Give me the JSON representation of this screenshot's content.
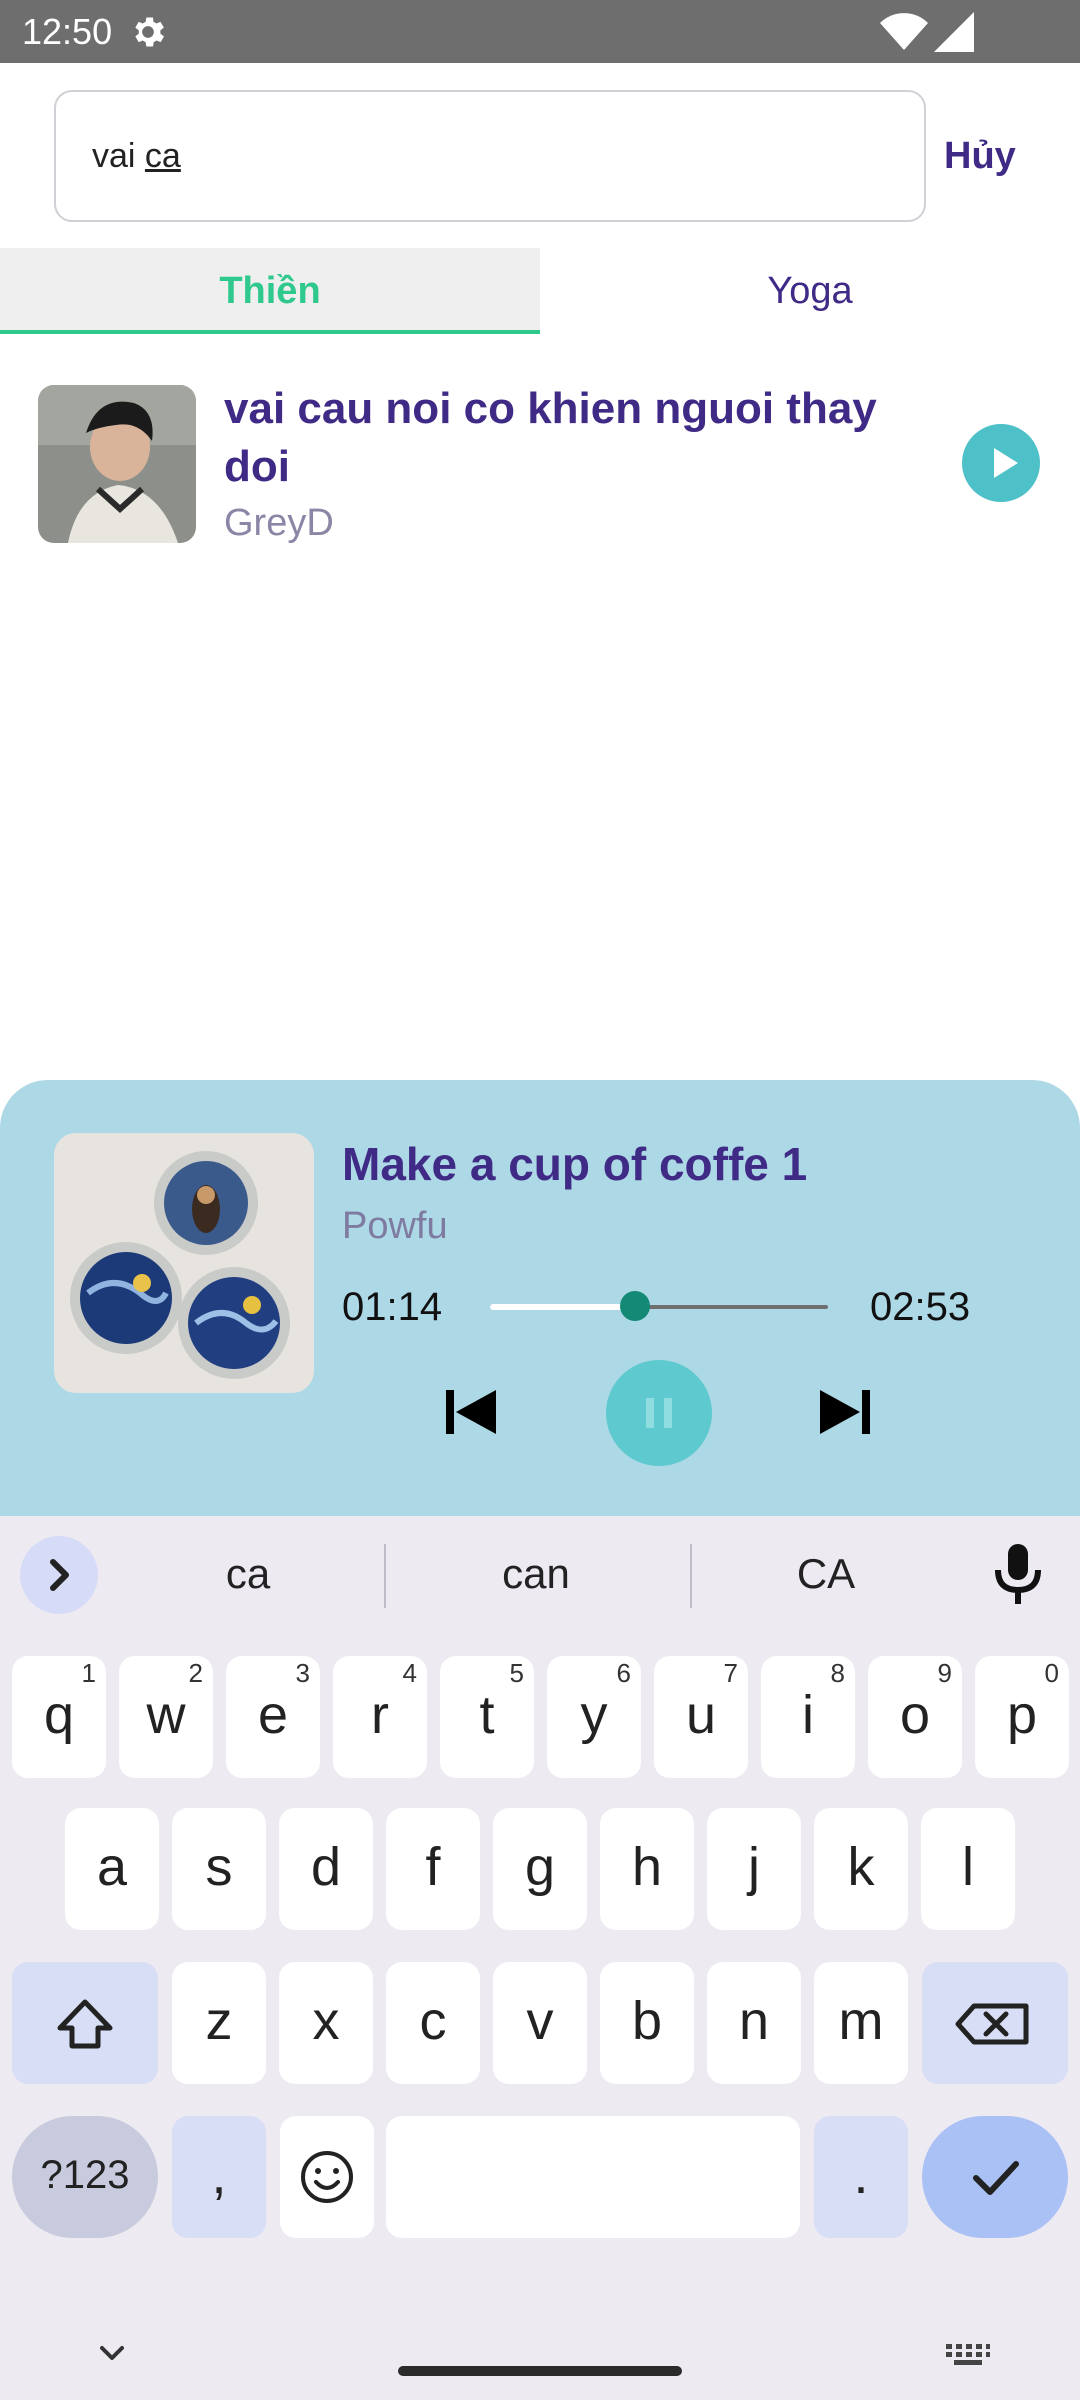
{
  "status_bar": {
    "time": "12:50"
  },
  "search": {
    "value_prefix": "vai ",
    "value_typed": "ca",
    "cancel_label": "Hủy"
  },
  "tabs": [
    {
      "label": "Thiền",
      "active": true
    },
    {
      "label": "Yoga",
      "active": false
    }
  ],
  "results": [
    {
      "title": "vai cau noi co khien nguoi thay doi",
      "artist": "GreyD"
    }
  ],
  "player": {
    "title": "Make a cup of coffe 1",
    "artist": "Powfu",
    "current_time": "01:14",
    "total_time": "02:53",
    "progress": 0.43
  },
  "keyboard": {
    "suggestions": [
      "ca",
      "can",
      "CA"
    ],
    "rows": [
      [
        [
          "q",
          "1"
        ],
        [
          "w",
          "2"
        ],
        [
          "e",
          "3"
        ],
        [
          "r",
          "4"
        ],
        [
          "t",
          "5"
        ],
        [
          "y",
          "6"
        ],
        [
          "u",
          "7"
        ],
        [
          "i",
          "8"
        ],
        [
          "o",
          "9"
        ],
        [
          "p",
          "0"
        ]
      ],
      [
        [
          "a",
          ""
        ],
        [
          "s",
          ""
        ],
        [
          "d",
          ""
        ],
        [
          "f",
          ""
        ],
        [
          "g",
          ""
        ],
        [
          "h",
          ""
        ],
        [
          "j",
          ""
        ],
        [
          "k",
          ""
        ],
        [
          "l",
          ""
        ]
      ],
      [
        [
          "z",
          ""
        ],
        [
          "x",
          ""
        ],
        [
          "c",
          ""
        ],
        [
          "v",
          ""
        ],
        [
          "b",
          ""
        ],
        [
          "n",
          ""
        ],
        [
          "m",
          ""
        ]
      ]
    ],
    "symbols_label": "?123",
    "comma_label": ",",
    "period_label": "."
  },
  "colors": {
    "accent_purple": "#3f2a86",
    "accent_green": "#2fc98e",
    "player_bg": "#add8e6",
    "play_teal": "#4dc0c8"
  }
}
